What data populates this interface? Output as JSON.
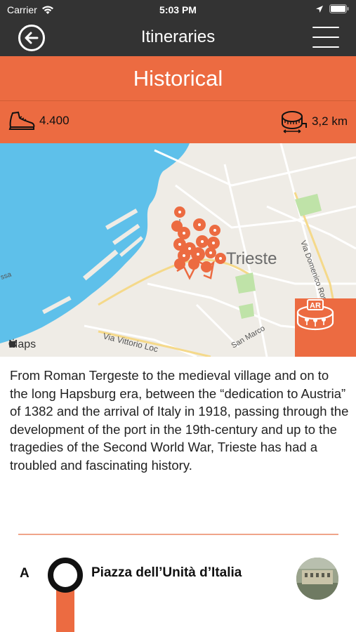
{
  "status_bar": {
    "carrier": "Carrier",
    "time": "5:03 PM"
  },
  "nav": {
    "title": "Itineraries"
  },
  "header": {
    "title": "Historical",
    "steps": "4.400",
    "distance": "3,2 km"
  },
  "map": {
    "city_label": "Trieste",
    "attribution": "Maps",
    "street_labels": [
      "Via Vittorio Loc",
      "Via Domenico Ros",
      "San Marco",
      "ssa"
    ],
    "ar_label": "AR"
  },
  "description": "From Roman Tergeste to the medieval village and on to the long Hapsburg era, between the “dedication to Austria” of 1382 and the arrival of Italy in 1918, passing through the development of the port in the 19th-century and up to the tragedies of the Second World War, Trieste has had a troubled and fascinating history.",
  "stops": [
    {
      "letter": "A",
      "name": "Piazza dell’Unità d’Italia"
    }
  ],
  "colors": {
    "accent": "#ec6b41",
    "bar": "#333333",
    "sea": "#5ec0ea",
    "land": "#efece6"
  }
}
